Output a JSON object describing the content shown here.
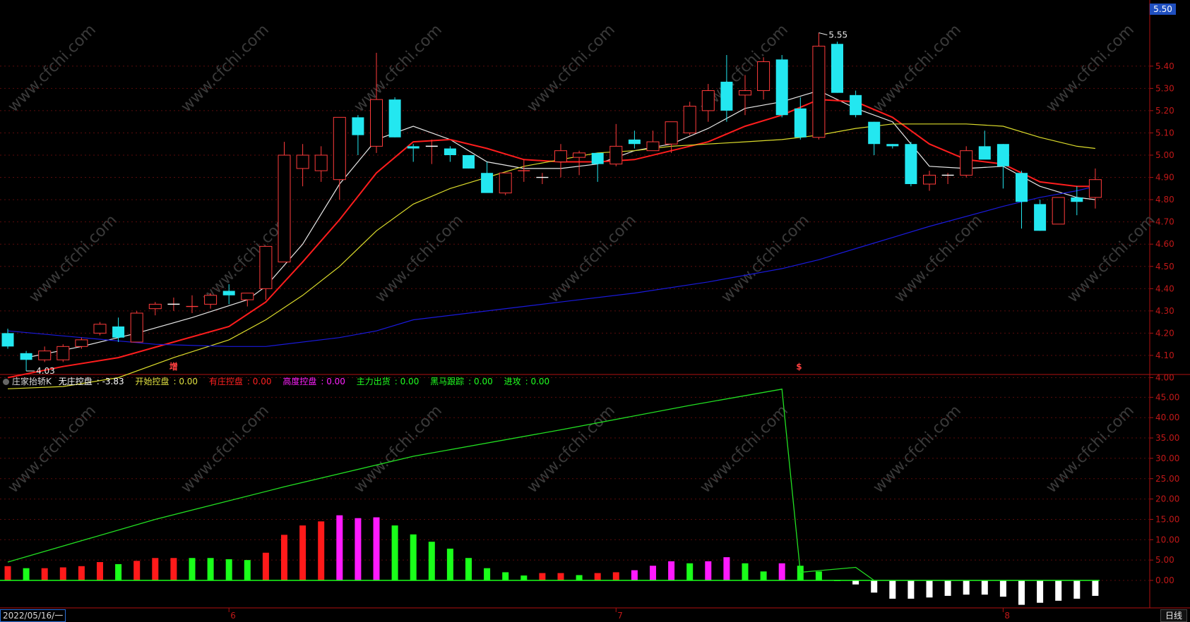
{
  "chart_data": {
    "type": "candlestick",
    "price_panel": {
      "ylim": [
        3.9,
        5.58
      ],
      "y_ticks": [
        "5.40",
        "5.30",
        "5.20",
        "5.10",
        "5.00",
        "4.90",
        "4.80",
        "4.70",
        "4.60",
        "4.50",
        "4.40",
        "4.30",
        "4.20",
        "4.10",
        "4.00"
      ],
      "current_price_tag": "5.50",
      "high_label": "5.55",
      "low_label": "4.03",
      "signal_marks": [
        {
          "bar": 9,
          "text": "增",
          "color": "#ff4040"
        },
        {
          "bar": 43,
          "text": "$",
          "color": "#ff4040"
        }
      ],
      "candles": [
        {
          "o": 4.2,
          "h": 4.22,
          "l": 4.13,
          "c": 4.14
        },
        {
          "o": 4.11,
          "h": 4.12,
          "l": 4.03,
          "c": 4.08
        },
        {
          "o": 4.08,
          "h": 4.14,
          "l": 4.07,
          "c": 4.12
        },
        {
          "o": 4.08,
          "h": 4.15,
          "l": 4.07,
          "c": 4.14
        },
        {
          "o": 4.14,
          "h": 4.18,
          "l": 4.13,
          "c": 4.17
        },
        {
          "o": 4.2,
          "h": 4.25,
          "l": 4.19,
          "c": 4.24
        },
        {
          "o": 4.23,
          "h": 4.27,
          "l": 4.16,
          "c": 4.18
        },
        {
          "o": 4.16,
          "h": 4.3,
          "l": 4.16,
          "c": 4.29
        },
        {
          "o": 4.31,
          "h": 4.34,
          "l": 4.28,
          "c": 4.33
        },
        {
          "o": 4.33,
          "h": 4.36,
          "l": 4.3,
          "c": 4.33
        },
        {
          "o": 4.32,
          "h": 4.37,
          "l": 4.29,
          "c": 4.32
        },
        {
          "o": 4.33,
          "h": 4.38,
          "l": 4.31,
          "c": 4.37
        },
        {
          "o": 4.39,
          "h": 4.42,
          "l": 4.33,
          "c": 4.37
        },
        {
          "o": 4.35,
          "h": 4.38,
          "l": 4.32,
          "c": 4.38
        },
        {
          "o": 4.4,
          "h": 4.45,
          "l": 4.35,
          "c": 4.59
        },
        {
          "o": 4.52,
          "h": 5.06,
          "l": 4.52,
          "c": 5.0
        },
        {
          "o": 4.94,
          "h": 5.05,
          "l": 4.86,
          "c": 5.0
        },
        {
          "o": 4.93,
          "h": 5.04,
          "l": 4.88,
          "c": 5.0
        },
        {
          "o": 4.89,
          "h": 5.17,
          "l": 4.8,
          "c": 5.17
        },
        {
          "o": 5.17,
          "h": 5.18,
          "l": 5.0,
          "c": 5.09
        },
        {
          "o": 5.04,
          "h": 5.46,
          "l": 5.01,
          "c": 5.25
        },
        {
          "o": 5.25,
          "h": 5.26,
          "l": 5.08,
          "c": 5.08
        },
        {
          "o": 5.04,
          "h": 5.05,
          "l": 4.97,
          "c": 5.03
        },
        {
          "o": 5.04,
          "h": 5.07,
          "l": 4.96,
          "c": 5.04
        },
        {
          "o": 5.03,
          "h": 5.04,
          "l": 4.97,
          "c": 5.0
        },
        {
          "o": 5.0,
          "h": 5.0,
          "l": 4.94,
          "c": 4.94
        },
        {
          "o": 4.92,
          "h": 4.97,
          "l": 4.86,
          "c": 4.83
        },
        {
          "o": 4.83,
          "h": 4.92,
          "l": 4.82,
          "c": 4.92
        },
        {
          "o": 4.93,
          "h": 4.98,
          "l": 4.88,
          "c": 4.93
        },
        {
          "o": 4.9,
          "h": 4.92,
          "l": 4.87,
          "c": 4.9
        },
        {
          "o": 4.97,
          "h": 5.05,
          "l": 4.9,
          "c": 5.02
        },
        {
          "o": 4.99,
          "h": 5.02,
          "l": 4.91,
          "c": 5.01
        },
        {
          "o": 5.01,
          "h": 5.01,
          "l": 4.88,
          "c": 4.96
        },
        {
          "o": 4.96,
          "h": 5.14,
          "l": 4.95,
          "c": 5.04
        },
        {
          "o": 5.07,
          "h": 5.11,
          "l": 5.03,
          "c": 5.05
        },
        {
          "o": 5.02,
          "h": 5.11,
          "l": 5.02,
          "c": 5.06
        },
        {
          "o": 5.05,
          "h": 5.15,
          "l": 5.01,
          "c": 5.15
        },
        {
          "o": 5.1,
          "h": 5.24,
          "l": 5.09,
          "c": 5.22
        },
        {
          "o": 5.2,
          "h": 5.32,
          "l": 5.15,
          "c": 5.29
        },
        {
          "o": 5.33,
          "h": 5.45,
          "l": 5.15,
          "c": 5.2
        },
        {
          "o": 5.27,
          "h": 5.36,
          "l": 5.18,
          "c": 5.29
        },
        {
          "o": 5.29,
          "h": 5.44,
          "l": 5.25,
          "c": 5.42
        },
        {
          "o": 5.43,
          "h": 5.45,
          "l": 5.17,
          "c": 5.18
        },
        {
          "o": 5.21,
          "h": 5.26,
          "l": 5.07,
          "c": 5.08
        },
        {
          "o": 5.08,
          "h": 5.55,
          "l": 5.07,
          "c": 5.49
        },
        {
          "o": 5.5,
          "h": 5.51,
          "l": 5.28,
          "c": 5.28
        },
        {
          "o": 5.27,
          "h": 5.29,
          "l": 5.17,
          "c": 5.18
        },
        {
          "o": 5.15,
          "h": 5.15,
          "l": 5.0,
          "c": 5.05
        },
        {
          "o": 5.05,
          "h": 5.05,
          "l": 5.03,
          "c": 5.04
        },
        {
          "o": 5.05,
          "h": 5.06,
          "l": 4.86,
          "c": 4.87
        },
        {
          "o": 4.87,
          "h": 4.93,
          "l": 4.84,
          "c": 4.91
        },
        {
          "o": 4.91,
          "h": 4.92,
          "l": 4.87,
          "c": 4.91
        },
        {
          "o": 4.91,
          "h": 5.04,
          "l": 4.9,
          "c": 5.02
        },
        {
          "o": 5.04,
          "h": 5.11,
          "l": 4.99,
          "c": 4.98
        },
        {
          "o": 5.05,
          "h": 5.05,
          "l": 4.85,
          "c": 4.95
        },
        {
          "o": 4.92,
          "h": 4.93,
          "l": 4.67,
          "c": 4.79
        },
        {
          "o": 4.78,
          "h": 4.8,
          "l": 4.66,
          "c": 4.66
        },
        {
          "o": 4.69,
          "h": 4.81,
          "l": 4.69,
          "c": 4.81
        },
        {
          "o": 4.81,
          "h": 4.86,
          "l": 4.73,
          "c": 4.79
        },
        {
          "o": 4.81,
          "h": 4.94,
          "l": 4.76,
          "c": 4.89
        }
      ],
      "ma": [
        {
          "color": "#e8e8e8",
          "points": [
            [
              1,
              4.09
            ],
            [
              4,
              4.14
            ],
            [
              7,
              4.2
            ],
            [
              10,
              4.27
            ],
            [
              13,
              4.35
            ],
            [
              14,
              4.41
            ],
            [
              16,
              4.6
            ],
            [
              18,
              4.87
            ],
            [
              20,
              5.07
            ],
            [
              22,
              5.13
            ],
            [
              24,
              5.07
            ],
            [
              26,
              4.97
            ],
            [
              28,
              4.94
            ],
            [
              30,
              4.94
            ],
            [
              32,
              4.96
            ],
            [
              34,
              5.02
            ],
            [
              36,
              5.05
            ],
            [
              38,
              5.12
            ],
            [
              40,
              5.21
            ],
            [
              42,
              5.24
            ],
            [
              44,
              5.29
            ],
            [
              46,
              5.21
            ],
            [
              48,
              5.15
            ],
            [
              50,
              4.95
            ],
            [
              52,
              4.94
            ],
            [
              54,
              4.95
            ],
            [
              56,
              4.86
            ],
            [
              58,
              4.81
            ],
            [
              59,
              4.8
            ]
          ]
        },
        {
          "color": "#ff1d1d",
          "points": [
            [
              0,
              4.0
            ],
            [
              3,
              4.05
            ],
            [
              6,
              4.09
            ],
            [
              9,
              4.16
            ],
            [
              12,
              4.23
            ],
            [
              14,
              4.34
            ],
            [
              16,
              4.52
            ],
            [
              18,
              4.71
            ],
            [
              20,
              4.92
            ],
            [
              22,
              5.06
            ],
            [
              24,
              5.07
            ],
            [
              26,
              5.03
            ],
            [
              28,
              4.98
            ],
            [
              30,
              4.97
            ],
            [
              32,
              4.97
            ],
            [
              34,
              4.98
            ],
            [
              36,
              5.02
            ],
            [
              38,
              5.06
            ],
            [
              40,
              5.13
            ],
            [
              42,
              5.18
            ],
            [
              44,
              5.25
            ],
            [
              46,
              5.24
            ],
            [
              48,
              5.17
            ],
            [
              50,
              5.05
            ],
            [
              52,
              4.98
            ],
            [
              54,
              4.96
            ],
            [
              56,
              4.88
            ],
            [
              58,
              4.86
            ],
            [
              59,
              4.86
            ]
          ]
        },
        {
          "color": "#dcdc2b",
          "points": [
            [
              0,
              3.95
            ],
            [
              3,
              3.96
            ],
            [
              6,
              4.0
            ],
            [
              9,
              4.09
            ],
            [
              12,
              4.17
            ],
            [
              14,
              4.26
            ],
            [
              16,
              4.37
            ],
            [
              18,
              4.5
            ],
            [
              20,
              4.66
            ],
            [
              22,
              4.78
            ],
            [
              24,
              4.85
            ],
            [
              26,
              4.9
            ],
            [
              28,
              4.95
            ],
            [
              30,
              4.98
            ],
            [
              32,
              5.01
            ],
            [
              34,
              5.02
            ],
            [
              36,
              5.04
            ],
            [
              38,
              5.05
            ],
            [
              40,
              5.06
            ],
            [
              42,
              5.07
            ],
            [
              44,
              5.09
            ],
            [
              46,
              5.12
            ],
            [
              48,
              5.14
            ],
            [
              50,
              5.14
            ],
            [
              52,
              5.14
            ],
            [
              54,
              5.13
            ],
            [
              56,
              5.08
            ],
            [
              58,
              5.04
            ],
            [
              59,
              5.03
            ]
          ]
        },
        {
          "color": "#1a1adc",
          "points": [
            [
              0,
              4.21
            ],
            [
              4,
              4.18
            ],
            [
              8,
              4.15
            ],
            [
              12,
              4.14
            ],
            [
              14,
              4.14
            ],
            [
              18,
              4.18
            ],
            [
              20,
              4.21
            ],
            [
              22,
              4.26
            ],
            [
              26,
              4.3
            ],
            [
              30,
              4.34
            ],
            [
              34,
              4.38
            ],
            [
              38,
              4.43
            ],
            [
              42,
              4.49
            ],
            [
              44,
              4.53
            ],
            [
              46,
              4.58
            ],
            [
              50,
              4.68
            ],
            [
              54,
              4.77
            ],
            [
              56,
              4.81
            ],
            [
              58,
              4.84
            ],
            [
              59,
              4.86
            ]
          ]
        }
      ]
    },
    "indicator_panel": {
      "name": "庄家抬轿K",
      "legend": [
        {
          "label": "无庄控盘",
          "value": "-3.83",
          "color": "#ffffff"
        },
        {
          "label": "开始控盘",
          "value": "0.00",
          "color": "#e0e040"
        },
        {
          "label": "有庄控盘",
          "value": "0.00",
          "color": "#ff2020"
        },
        {
          "label": "高度控盘",
          "value": "0.00",
          "color": "#ff20ff"
        },
        {
          "label": "主力出货",
          "value": "0.00",
          "color": "#20ff20"
        },
        {
          "label": "黑马跟踪",
          "value": "0.00",
          "color": "#20ff20"
        },
        {
          "label": "进攻",
          "value": "0.00",
          "color": "#20ff20"
        }
      ],
      "ylim": [
        -7,
        50
      ],
      "y_ticks": [
        "45.00",
        "40.00",
        "35.00",
        "30.00",
        "25.00",
        "20.00",
        "15.00",
        "10.00",
        "5.00",
        "0.00"
      ],
      "bars": [
        {
          "v": 3.5,
          "c": "r"
        },
        {
          "v": 3.0,
          "c": "g"
        },
        {
          "v": 3.0,
          "c": "r"
        },
        {
          "v": 3.2,
          "c": "r"
        },
        {
          "v": 3.5,
          "c": "r"
        },
        {
          "v": 4.5,
          "c": "r"
        },
        {
          "v": 4.0,
          "c": "g"
        },
        {
          "v": 4.8,
          "c": "r"
        },
        {
          "v": 5.5,
          "c": "r"
        },
        {
          "v": 5.5,
          "c": "r"
        },
        {
          "v": 5.5,
          "c": "g"
        },
        {
          "v": 5.5,
          "c": "g"
        },
        {
          "v": 5.2,
          "c": "g"
        },
        {
          "v": 5.0,
          "c": "g"
        },
        {
          "v": 6.8,
          "c": "r"
        },
        {
          "v": 11.2,
          "c": "r"
        },
        {
          "v": 13.5,
          "c": "r"
        },
        {
          "v": 14.5,
          "c": "r"
        },
        {
          "v": 16.0,
          "c": "m"
        },
        {
          "v": 15.3,
          "c": "m"
        },
        {
          "v": 15.5,
          "c": "m"
        },
        {
          "v": 13.5,
          "c": "g"
        },
        {
          "v": 11.3,
          "c": "g"
        },
        {
          "v": 9.5,
          "c": "g"
        },
        {
          "v": 7.8,
          "c": "g"
        },
        {
          "v": 5.5,
          "c": "g"
        },
        {
          "v": 3.0,
          "c": "g"
        },
        {
          "v": 2.0,
          "c": "g"
        },
        {
          "v": 1.2,
          "c": "g"
        },
        {
          "v": 1.8,
          "c": "r"
        },
        {
          "v": 1.8,
          "c": "r"
        },
        {
          "v": 1.3,
          "c": "g"
        },
        {
          "v": 1.8,
          "c": "r"
        },
        {
          "v": 2.0,
          "c": "r"
        },
        {
          "v": 2.5,
          "c": "m"
        },
        {
          "v": 3.6,
          "c": "m"
        },
        {
          "v": 4.7,
          "c": "m"
        },
        {
          "v": 4.2,
          "c": "g"
        },
        {
          "v": 4.7,
          "c": "m"
        },
        {
          "v": 5.7,
          "c": "m"
        },
        {
          "v": 4.2,
          "c": "g"
        },
        {
          "v": 2.2,
          "c": "g"
        },
        {
          "v": 4.2,
          "c": "m"
        },
        {
          "v": 3.6,
          "c": "g"
        },
        {
          "v": 2.2,
          "c": "g"
        },
        {
          "v": 0.0,
          "c": "g"
        },
        {
          "v": -1.0,
          "c": "w"
        },
        {
          "v": -3.0,
          "c": "w"
        },
        {
          "v": -4.5,
          "c": "w"
        },
        {
          "v": -4.5,
          "c": "w"
        },
        {
          "v": -4.2,
          "c": "w"
        },
        {
          "v": -3.8,
          "c": "w"
        },
        {
          "v": -3.5,
          "c": "w"
        },
        {
          "v": -3.5,
          "c": "w"
        },
        {
          "v": -4.0,
          "c": "w"
        },
        {
          "v": -6.0,
          "c": "w"
        },
        {
          "v": -5.5,
          "c": "w"
        },
        {
          "v": -5.0,
          "c": "w"
        },
        {
          "v": -4.5,
          "c": "w"
        },
        {
          "v": -3.8,
          "c": "w"
        }
      ],
      "line": [
        [
          0,
          4.5
        ],
        [
          8,
          15.0
        ],
        [
          15,
          23.0
        ],
        [
          22,
          30.5
        ],
        [
          30,
          37.0
        ],
        [
          37,
          43.0
        ],
        [
          42,
          47.0
        ],
        [
          43,
          2.0
        ],
        [
          46,
          3.2
        ],
        [
          47,
          0.0
        ],
        [
          59,
          0.0
        ]
      ]
    },
    "x_axis": {
      "labels": [
        {
          "bar": 12,
          "text": "6"
        },
        {
          "bar": 33,
          "text": "7"
        },
        {
          "bar": 54,
          "text": "8"
        }
      ]
    }
  },
  "status": {
    "date": "2022/05/16/一",
    "mode": "日线"
  },
  "watermark": "www.cfchi.com"
}
